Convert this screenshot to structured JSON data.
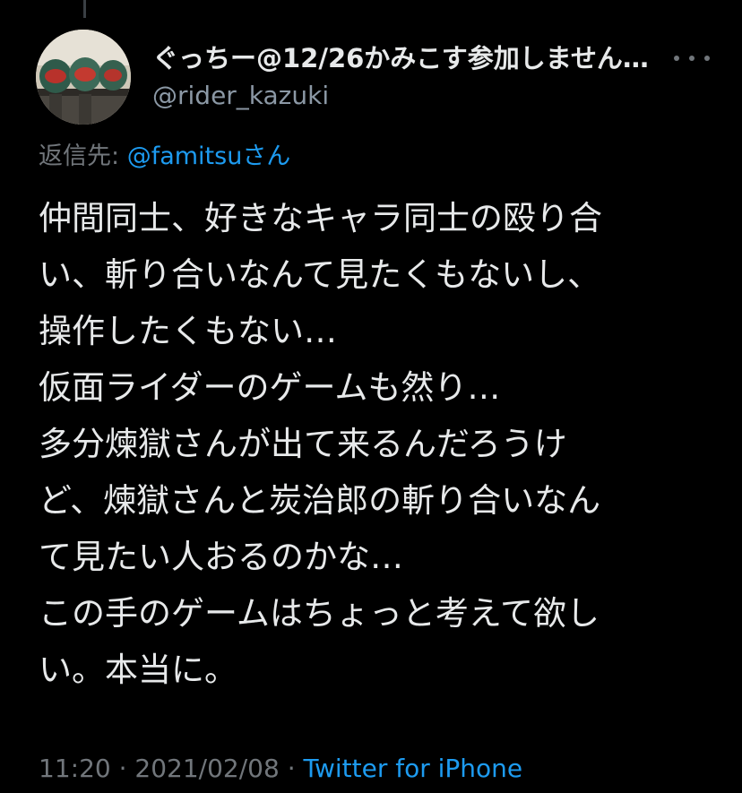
{
  "tweet": {
    "author": {
      "display_name": "ぐっちー@12/26かみこす参加しません…",
      "handle": "@rider_kazuki",
      "avatar_icon": "rider-helmets-avatar"
    },
    "more_icon": "more-horizontal-icon",
    "reply_to": {
      "prefix": "返信先: ",
      "mention": "@famitsu",
      "suffix": "さん"
    },
    "body_lines": [
      "仲間同士、好きなキャラ同士の殴り合",
      "い、斬り合いなんて見たくもないし、",
      "操作したくもない…",
      "仮面ライダーのゲームも然り…",
      "多分煉獄さんが出て来るんだろうけ",
      "ど、煉獄さんと炭治郎の斬り合いなん",
      "て見たい人おるのかな…",
      "この手のゲームはちょっと考えて欲し",
      "い。本当に。"
    ],
    "time": "11:20",
    "separator": " · ",
    "date": "2021/02/08",
    "source": "Twitter for iPhone"
  },
  "colors": {
    "background": "#000000",
    "primary_text": "#e7e9ea",
    "secondary_text": "#71767b",
    "link": "#1d9bf0"
  }
}
